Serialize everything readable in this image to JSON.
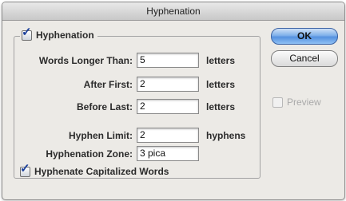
{
  "window": {
    "title": "Hyphenation"
  },
  "group": {
    "label": "Hyphenation",
    "checked": true
  },
  "fields": {
    "words_longer_than": {
      "label": "Words Longer Than:",
      "value": "5",
      "unit": "letters"
    },
    "after_first": {
      "label": "After First:",
      "value": "2",
      "unit": "letters"
    },
    "before_last": {
      "label": "Before Last:",
      "value": "2",
      "unit": "letters"
    },
    "hyphen_limit": {
      "label": "Hyphen Limit:",
      "value": "2",
      "unit": "hyphens"
    },
    "hyphenation_zone": {
      "label": "Hyphenation Zone:",
      "value": "3 pica"
    }
  },
  "hyphenate_capitalized": {
    "label": "Hyphenate Capitalized Words",
    "checked": true
  },
  "buttons": {
    "ok": "OK",
    "cancel": "Cancel"
  },
  "preview": {
    "label": "Preview",
    "checked": false,
    "enabled": false
  },
  "colors": {
    "default_button": "#5591df",
    "checkmark": "#1a3f9a"
  }
}
